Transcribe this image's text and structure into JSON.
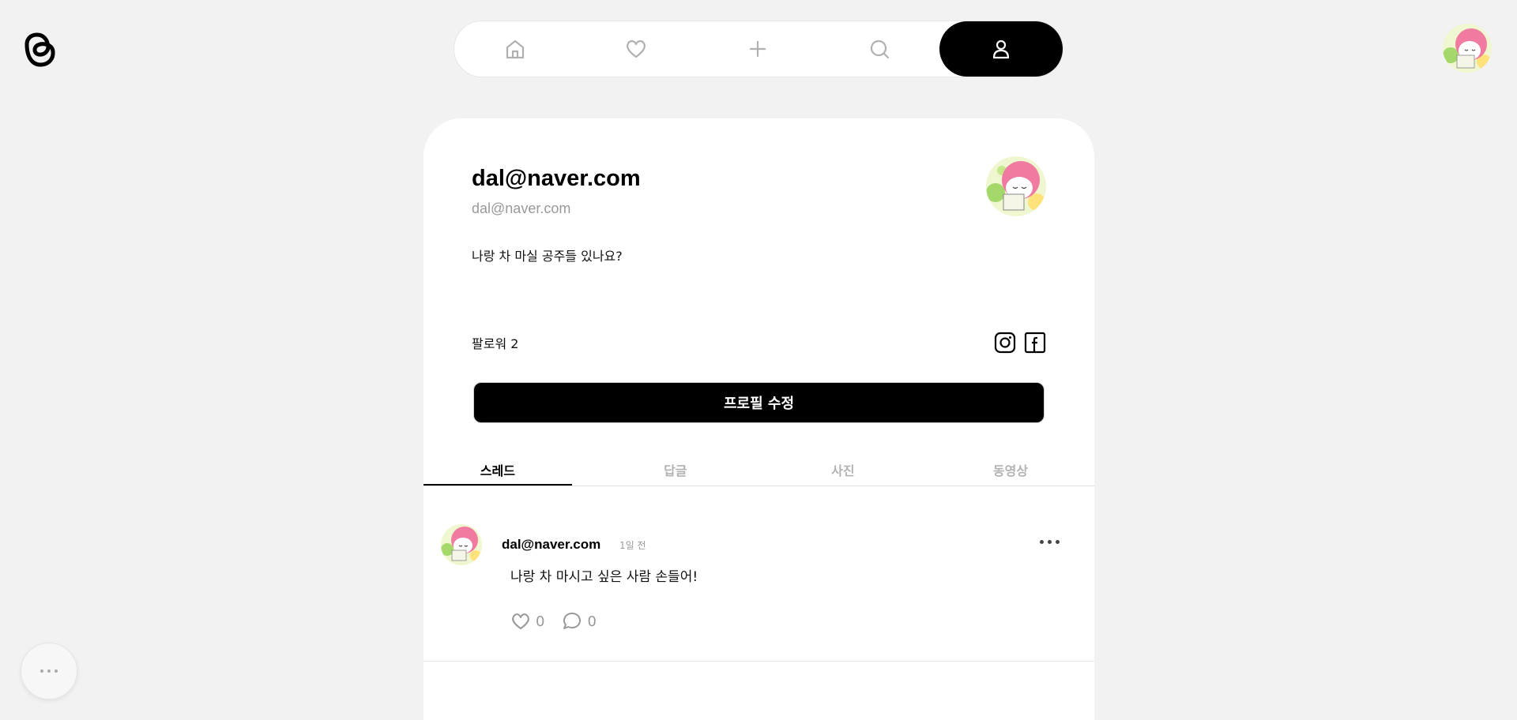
{
  "nav": {
    "items": [
      {
        "icon": "home-icon"
      },
      {
        "icon": "heart-icon"
      },
      {
        "icon": "plus-icon"
      },
      {
        "icon": "search-icon"
      },
      {
        "icon": "profile-icon",
        "active": true
      }
    ]
  },
  "profile": {
    "username": "dal@naver.com",
    "handle": "dal@naver.com",
    "bio": "나랑 차 마실 공주들 있나요?",
    "followers": "팔로워 2",
    "edit_button": "프로필 수정",
    "socials": [
      "instagram-icon",
      "facebook-icon"
    ]
  },
  "tabs": [
    {
      "label": "스레드",
      "active": true
    },
    {
      "label": "답글"
    },
    {
      "label": "사진"
    },
    {
      "label": "동영상"
    }
  ],
  "posts": [
    {
      "user": "dal@naver.com",
      "time": "1일 전",
      "text": "나랑 차 마시고 싶은 사람 손들어!",
      "likes": "0",
      "comments": "0"
    }
  ],
  "colors": {
    "background": "#f2f2f2",
    "card": "#ffffff",
    "accent": "#000000",
    "avatar_pink": "#f06292",
    "muted": "#999999"
  }
}
